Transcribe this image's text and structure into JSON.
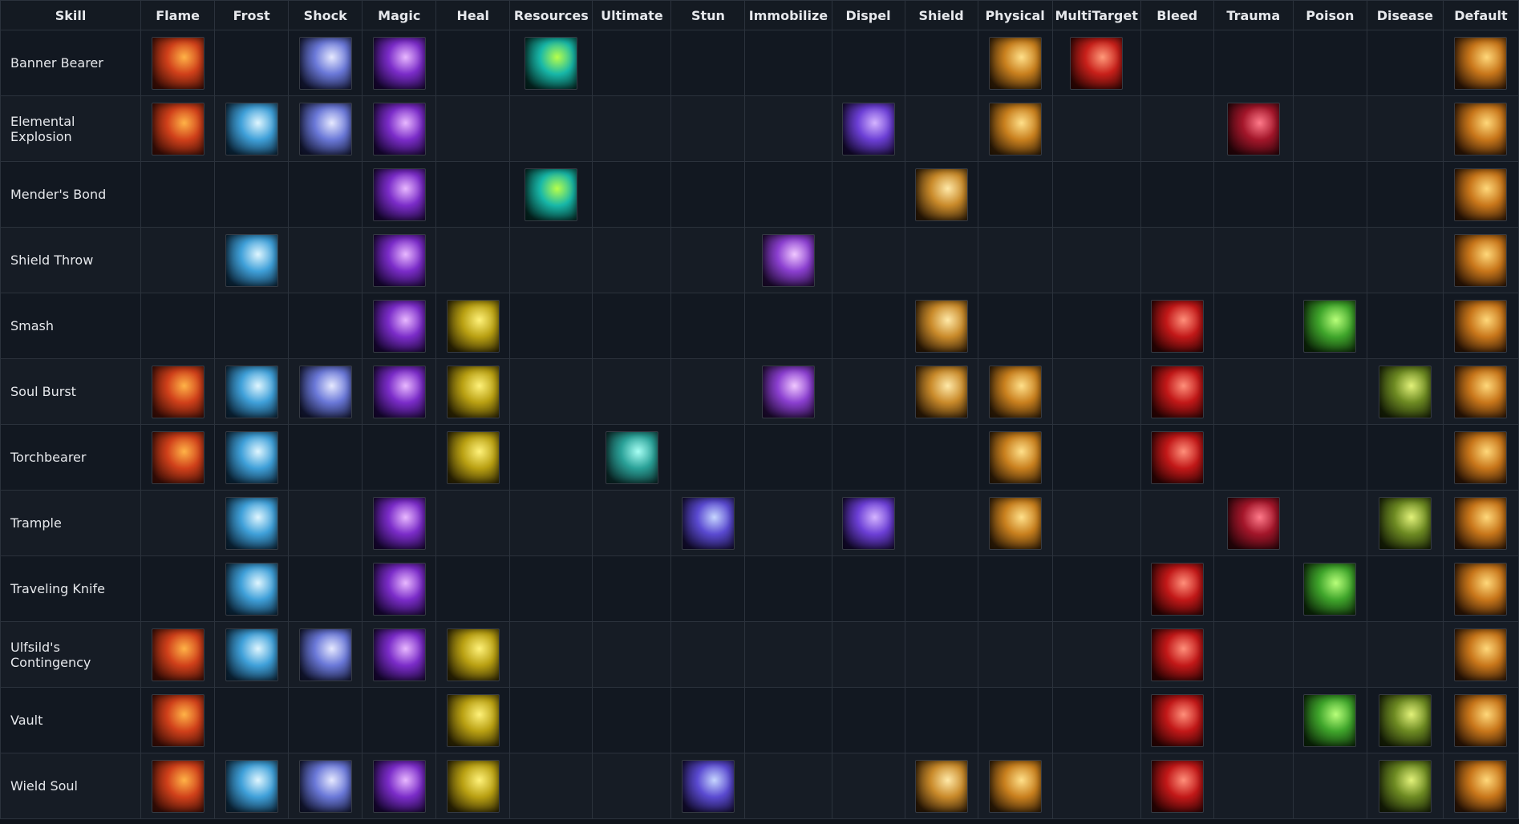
{
  "header": {
    "skill": "Skill",
    "columns": [
      "Flame",
      "Frost",
      "Shock",
      "Magic",
      "Heal",
      "Resources",
      "Ultimate",
      "Stun",
      "Immobilize",
      "Dispel",
      "Shield",
      "Physical",
      "MultiTarget",
      "Bleed",
      "Trauma",
      "Poison",
      "Disease",
      "Default"
    ]
  },
  "palette": {
    "Flame": [
      "#ffb347",
      "#d0401a",
      "#3a0d06"
    ],
    "Frost": [
      "#dff6ff",
      "#3fa0d9",
      "#0b2438"
    ],
    "Shock": [
      "#e6e9ff",
      "#6a78d8",
      "#121631"
    ],
    "Magic": [
      "#e8b8ff",
      "#7b2cc9",
      "#160631"
    ],
    "Heal": [
      "#fff27a",
      "#b9a012",
      "#2b2303"
    ],
    "Resources": [
      "#b8ff4a",
      "#17b7a8",
      "#042420"
    ],
    "Ultimate": [
      "#a8fff4",
      "#2aa198",
      "#0a2626"
    ],
    "Stun": [
      "#c6d6ff",
      "#5a4ad1",
      "#120c2e"
    ],
    "Immobilize": [
      "#f0c8ff",
      "#8b3fd0",
      "#1c0a2e"
    ],
    "Dispel": [
      "#d4b4ff",
      "#6c3fd6",
      "#12092b"
    ],
    "Shield": [
      "#ffe9a8",
      "#c98a2a",
      "#2a1805"
    ],
    "Physical": [
      "#ffe08a",
      "#c9801e",
      "#2c1a06"
    ],
    "MultiTarget": [
      "#ff9a7a",
      "#c8201a",
      "#2e0503"
    ],
    "Bleed": [
      "#ff8f7a",
      "#c21818",
      "#2a0303"
    ],
    "Trauma": [
      "#ff7a8a",
      "#a3162a",
      "#260409"
    ],
    "Poison": [
      "#b8ff7a",
      "#3fa52b",
      "#0b2508"
    ],
    "Disease": [
      "#e2f27a",
      "#6d8a22",
      "#151e06"
    ],
    "Default": [
      "#ffd87a",
      "#c8761a",
      "#2a1405"
    ]
  },
  "rows": [
    {
      "skill": "Banner Bearer",
      "icons": [
        "Flame",
        "Shock",
        "Magic",
        "Resources",
        "Physical",
        "MultiTarget",
        "Default"
      ]
    },
    {
      "skill": "Elemental Explosion",
      "icons": [
        "Flame",
        "Frost",
        "Shock",
        "Magic",
        "Dispel",
        "Physical",
        "Trauma",
        "Default"
      ]
    },
    {
      "skill": "Mender's Bond",
      "icons": [
        "Magic",
        "Resources",
        "Shield",
        "Default"
      ]
    },
    {
      "skill": "Shield Throw",
      "icons": [
        "Frost",
        "Magic",
        "Immobilize",
        "Default"
      ]
    },
    {
      "skill": "Smash",
      "icons": [
        "Magic",
        "Heal",
        "Shield",
        "Bleed",
        "Poison",
        "Default"
      ]
    },
    {
      "skill": "Soul Burst",
      "icons": [
        "Flame",
        "Frost",
        "Shock",
        "Magic",
        "Heal",
        "Immobilize",
        "Shield",
        "Physical",
        "Bleed",
        "Disease",
        "Default"
      ]
    },
    {
      "skill": "Torchbearer",
      "icons": [
        "Flame",
        "Frost",
        "Heal",
        "Ultimate",
        "Physical",
        "Bleed",
        "Default"
      ]
    },
    {
      "skill": "Trample",
      "icons": [
        "Frost",
        "Magic",
        "Stun",
        "Dispel",
        "Physical",
        "Trauma",
        "Disease",
        "Default"
      ]
    },
    {
      "skill": "Traveling Knife",
      "icons": [
        "Frost",
        "Magic",
        "Bleed",
        "Poison",
        "Default"
      ]
    },
    {
      "skill": "Ulfsild's Contingency",
      "icons": [
        "Flame",
        "Frost",
        "Shock",
        "Magic",
        "Heal",
        "Bleed",
        "Default"
      ]
    },
    {
      "skill": "Vault",
      "icons": [
        "Flame",
        "Heal",
        "Bleed",
        "Poison",
        "Disease",
        "Default"
      ]
    },
    {
      "skill": "Wield Soul",
      "icons": [
        "Flame",
        "Frost",
        "Shock",
        "Magic",
        "Heal",
        "Stun",
        "Shield",
        "Physical",
        "Bleed",
        "Disease",
        "Default"
      ]
    }
  ]
}
